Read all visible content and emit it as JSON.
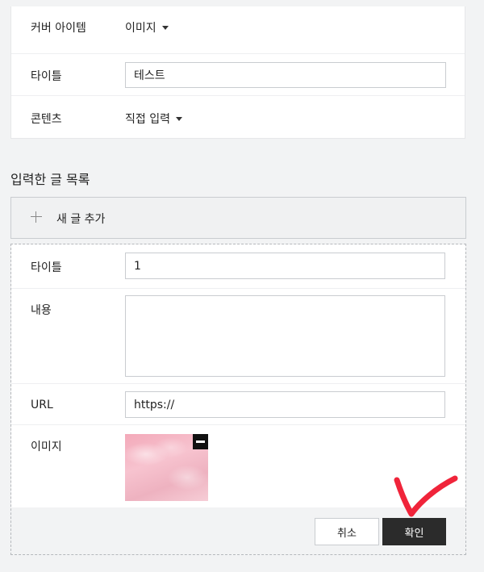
{
  "cover": {
    "label": "커버 아이템",
    "value": "이미지"
  },
  "title_row": {
    "label": "타이틀",
    "value": "테스트"
  },
  "content_row": {
    "label": "콘텐츠",
    "value": "직접 입력"
  },
  "list": {
    "heading": "입력한 글 목록",
    "add_label": "새 글 추가"
  },
  "form": {
    "title_label": "타이틀",
    "title_value": "1",
    "content_label": "내용",
    "content_value": "",
    "url_label": "URL",
    "url_value": "https://",
    "image_label": "이미지",
    "cancel_label": "취소",
    "confirm_label": "확인"
  },
  "colors": {
    "confirm_bg": "#2b2b2b",
    "annotation_red": "#f0243a",
    "page_bg": "#f2f3f4"
  },
  "icons": {
    "dropdown": "caret-down-icon",
    "add": "plus-icon",
    "remove_image": "minus-icon"
  }
}
